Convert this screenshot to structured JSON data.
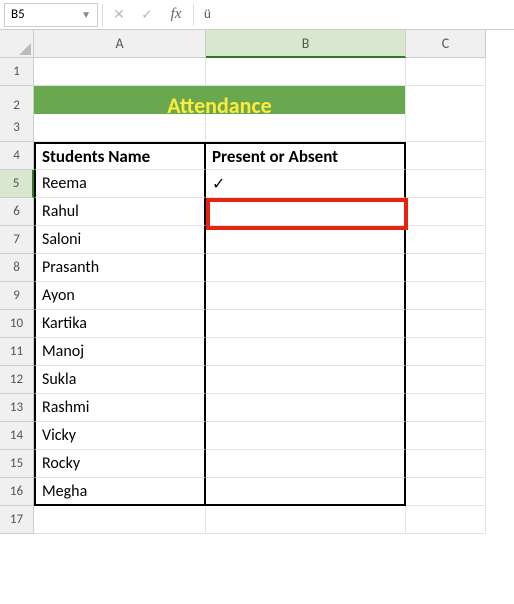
{
  "name_box": "B5",
  "formula_content": "ü",
  "col_heads": [
    "A",
    "B",
    "C"
  ],
  "title": "Attendance",
  "headers": {
    "a": "Students Name",
    "b": "Present or Absent"
  },
  "rows": [
    {
      "n": "5",
      "name": "Reema",
      "status": "✓"
    },
    {
      "n": "6",
      "name": "Rahul",
      "status": ""
    },
    {
      "n": "7",
      "name": "Saloni",
      "status": ""
    },
    {
      "n": "8",
      "name": "Prasanth",
      "status": ""
    },
    {
      "n": "9",
      "name": "Ayon",
      "status": ""
    },
    {
      "n": "10",
      "name": "Kartika",
      "status": ""
    },
    {
      "n": "11",
      "name": "Manoj",
      "status": ""
    },
    {
      "n": "12",
      "name": "Sukla",
      "status": ""
    },
    {
      "n": "13",
      "name": "Rashmi",
      "status": ""
    },
    {
      "n": "14",
      "name": "Vicky",
      "status": ""
    },
    {
      "n": "15",
      "name": "Rocky",
      "status": ""
    },
    {
      "n": "16",
      "name": "Megha",
      "status": ""
    }
  ],
  "extra_row_17": "17",
  "active_cell": "B5",
  "highlight_cell": "B5"
}
